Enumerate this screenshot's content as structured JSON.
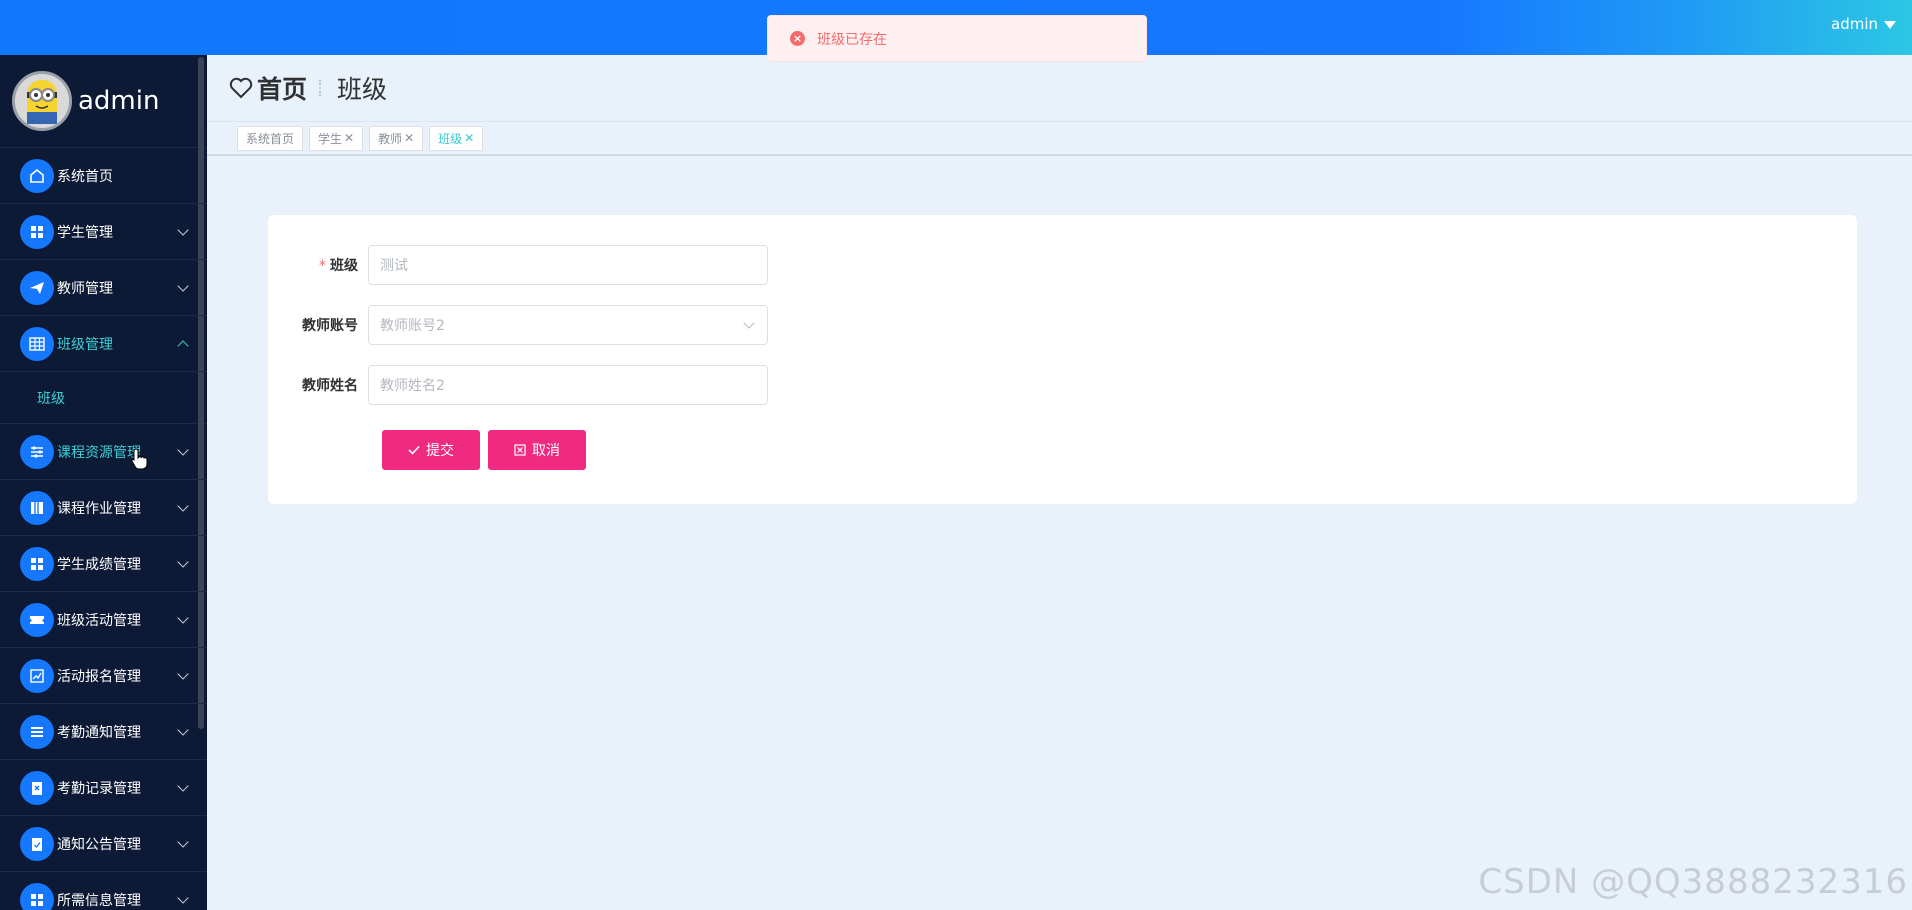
{
  "topbar": {
    "user": "admin"
  },
  "toast": {
    "message": "班级已存在"
  },
  "sidebar": {
    "profile_name": "admin",
    "items": [
      {
        "label": "系统首页",
        "icon": "home-icon",
        "expandable": false
      },
      {
        "label": "学生管理",
        "icon": "grid-icon",
        "expandable": true
      },
      {
        "label": "教师管理",
        "icon": "paper-plane-icon",
        "expandable": true
      },
      {
        "label": "班级管理",
        "icon": "table-icon",
        "expandable": true,
        "expanded": true
      },
      {
        "label": "班级",
        "submenu": true
      },
      {
        "label": "课程资源管理",
        "icon": "sliders-icon",
        "expandable": true
      },
      {
        "label": "课程作业管理",
        "icon": "book-icon",
        "expandable": true
      },
      {
        "label": "学生成绩管理",
        "icon": "grid-icon",
        "expandable": true
      },
      {
        "label": "班级活动管理",
        "icon": "ticket-icon",
        "expandable": true
      },
      {
        "label": "活动报名管理",
        "icon": "chart-icon",
        "expandable": true
      },
      {
        "label": "考勤通知管理",
        "icon": "list-icon",
        "expandable": true
      },
      {
        "label": "考勤记录管理",
        "icon": "clipboard-icon",
        "expandable": true
      },
      {
        "label": "通知公告管理",
        "icon": "clipboard-check-icon",
        "expandable": true
      },
      {
        "label": "所需信息管理",
        "icon": "grid-icon",
        "expandable": true
      }
    ]
  },
  "header": {
    "home": "首页",
    "current": "班级"
  },
  "tags": [
    {
      "label": "系统首页",
      "closable": false
    },
    {
      "label": "学生",
      "closable": true
    },
    {
      "label": "教师",
      "closable": true
    },
    {
      "label": "班级",
      "closable": true,
      "active": true
    }
  ],
  "form": {
    "class_label": "班级",
    "class_value": "测试",
    "teacher_account_label": "教师账号",
    "teacher_account_placeholder": "教师账号2",
    "teacher_name_label": "教师姓名",
    "teacher_name_placeholder": "教师姓名2",
    "submit_label": "提交",
    "cancel_label": "取消"
  },
  "watermark": "CSDN @QQ3888232316",
  "colors": {
    "primary": "#1677ff",
    "accent": "#ef2a80",
    "active_text": "#3bd0d6",
    "sidebar_bg": "#0c1a35"
  }
}
